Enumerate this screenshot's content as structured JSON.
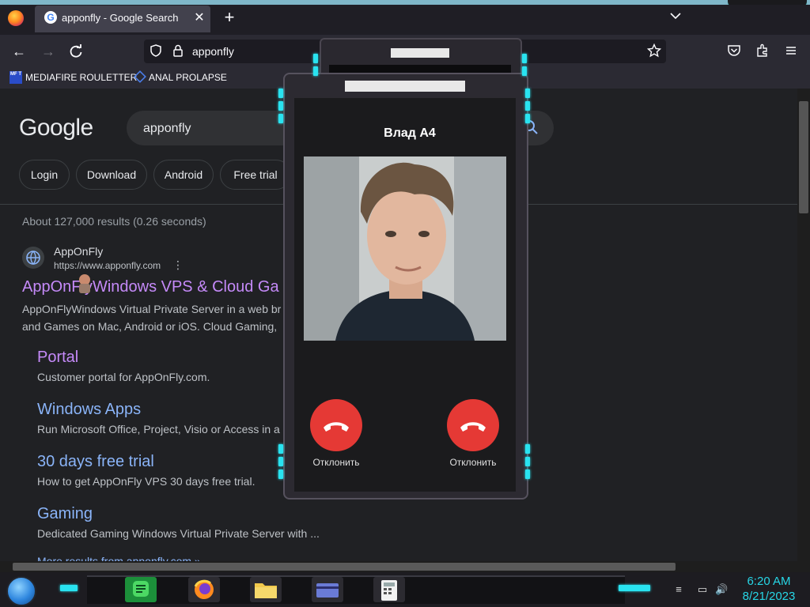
{
  "browser": {
    "tab_title": "apponfly - Google Search",
    "url": "apponfly",
    "bookmarks": [
      {
        "label": "MEDIAFIRE ROULETTER",
        "icon": "mediafire-icon",
        "icon_text": "MF T"
      },
      {
        "label": "ANAL PROLAPSE",
        "icon": "bookmark-logo-icon"
      }
    ]
  },
  "google": {
    "logo": "Google",
    "query": "apponfly",
    "chips": [
      "Login",
      "Download",
      "Android",
      "Free trial"
    ],
    "stats": "About 127,000 results (0.26 seconds)",
    "result": {
      "site_name": "AppOnFly",
      "site_url": "https://www.apponfly.com",
      "title_part1": "AppOnFly",
      "title_part2": "Windows VPS & Cloud Ga",
      "snippet1": "AppOnFlyWindows Virtual Private Server in a web br",
      "snippet2": "and Games on Mac, Android or iOS. Cloud Gaming,"
    },
    "sublinks": [
      {
        "title": "Portal",
        "snippet": "Customer portal for AppOnFly.com."
      },
      {
        "title": "Windows Apps",
        "snippet": "Run Microsoft Office, Project, Visio or Access in a"
      },
      {
        "title": "30 days free trial",
        "snippet": "How to get AppOnFly VPS 30 days free trial."
      },
      {
        "title": "Gaming",
        "snippet": "Dedicated Gaming Windows Virtual Private Server with ..."
      }
    ],
    "more": "More results from apponfly.com »"
  },
  "call": {
    "caller_name": "Влад А4",
    "buttons": [
      {
        "label": "Отклонить"
      },
      {
        "label": "Отклонить"
      }
    ],
    "decline_color": "#e53935"
  },
  "taskbar": {
    "time": "6:20 AM",
    "date": "8/21/2023",
    "apps": [
      "messages-app-icon",
      "firefox-app-icon",
      "file-explorer-icon",
      "card-app-icon",
      "calculator-app-icon"
    ]
  },
  "colors": {
    "accent_cyan": "#29e3f0",
    "link_blue": "#8ab4f8",
    "link_visited": "#c58af9"
  }
}
